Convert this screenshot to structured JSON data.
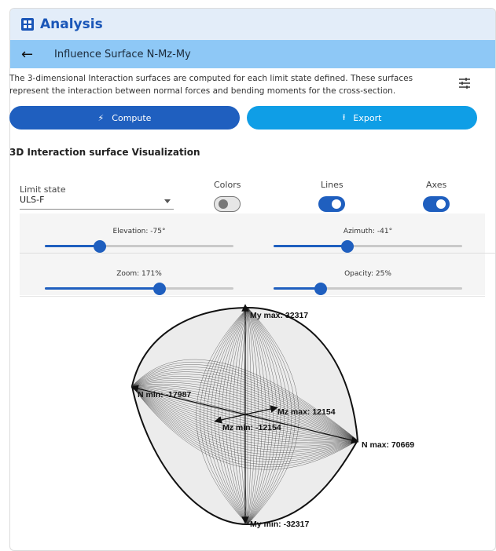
{
  "app": {
    "title": "Analysis"
  },
  "subheader": {
    "title": "Influence Surface N-Mz-My"
  },
  "description": "The 3-dimensional Interaction surfaces are computed for each limit state defined. These surfaces represent the interaction between normal forces and bending moments for the cross-section.",
  "buttons": {
    "compute": "Compute",
    "export": "Export"
  },
  "section_title": "3D Interaction surface Visualization",
  "controls": {
    "limit_state_label": "Limit state",
    "limit_state_value": "ULS-F",
    "colors_label": "Colors",
    "lines_label": "Lines",
    "axes_label": "Axes",
    "colors_on": false,
    "lines_on": true,
    "axes_on": true
  },
  "sliders": {
    "elevation": {
      "label": "Elevation: -75°",
      "fraction": 0.29
    },
    "azimuth": {
      "label": "Azimuth: -41°",
      "fraction": 0.39
    },
    "zoom": {
      "label": "Zoom: 171%",
      "fraction": 0.61
    },
    "opacity": {
      "label": "Opacity: 25%",
      "fraction": 0.25
    }
  },
  "viz_labels": {
    "my_max": "My max: 32317",
    "my_min": "My min: -32317",
    "n_min": "N min: -17987",
    "n_max": "N max: 70669",
    "mz_max": "Mz max: 12154",
    "mz_min": "Mz min: -12154"
  },
  "colors": {
    "primary": "#1f5fbf",
    "export": "#0f9ee6",
    "header_bg": "#e3edf9",
    "subheader_bg": "#8ec8f6"
  }
}
